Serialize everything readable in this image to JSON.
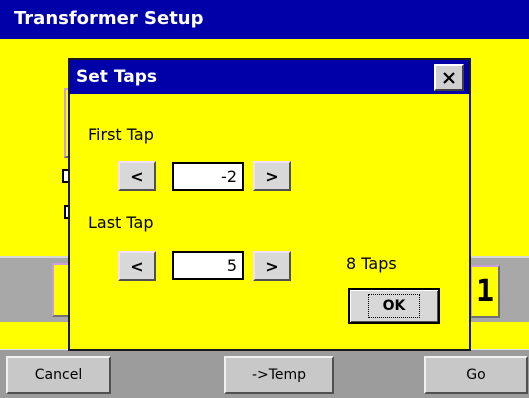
{
  "window": {
    "title": "Transformer Setup"
  },
  "background": {
    "partial_button_text": "1"
  },
  "dialog": {
    "title": "Set Taps",
    "close_icon": "close-icon",
    "first_tap": {
      "label": "First Tap",
      "value": "-2",
      "decrement": "<",
      "increment": ">"
    },
    "last_tap": {
      "label": "Last Tap",
      "value": "5",
      "decrement": "<",
      "increment": ">"
    },
    "taps_count": "8 Taps",
    "ok_label": "OK"
  },
  "toolbar": {
    "cancel": "Cancel",
    "temp": "->Temp",
    "go": "Go"
  },
  "colors": {
    "title_bar": "#0000a8",
    "background": "#ffff00",
    "panel": "#a8a8a8",
    "toolbar": "#9c9c9c"
  }
}
